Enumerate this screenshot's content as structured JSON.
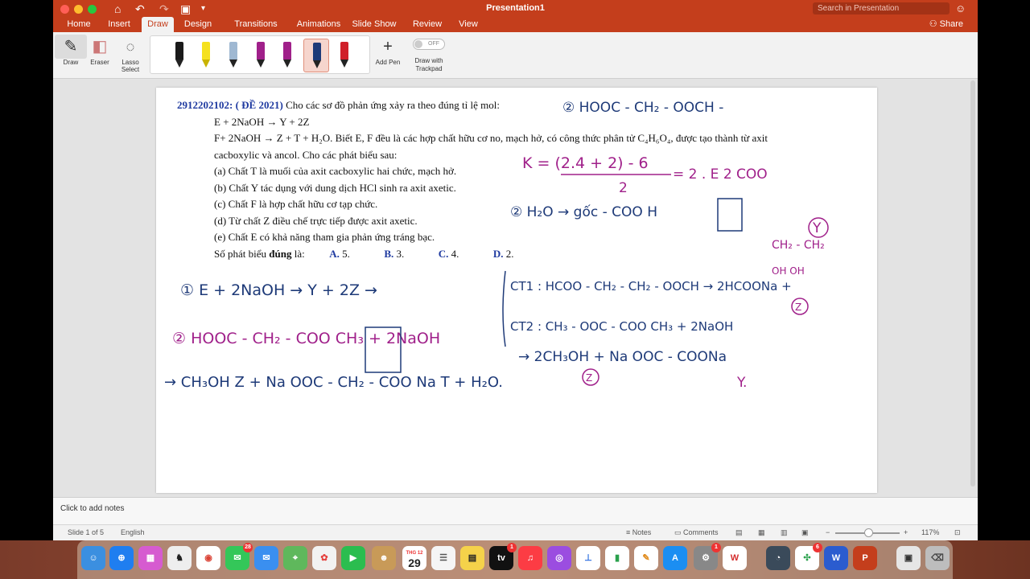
{
  "window": {
    "title": "Presentation1",
    "search_placeholder": "Search in Presentation",
    "share_label": "Share"
  },
  "tabs": [
    {
      "label": "Home"
    },
    {
      "label": "Insert"
    },
    {
      "label": "Draw"
    },
    {
      "label": "Design"
    },
    {
      "label": "Transitions"
    },
    {
      "label": "Animations"
    },
    {
      "label": "Slide Show"
    },
    {
      "label": "Review"
    },
    {
      "label": "View"
    }
  ],
  "ribbon": {
    "draw_label": "Draw",
    "eraser_label": "Eraser",
    "lasso_label": "Lasso Select",
    "add_pen_label": "Add Pen",
    "toggle_label": "OFF",
    "trackpad_label": "Draw with Trackpad",
    "pen_colors": [
      "#1a1a1a",
      "#f5e11e",
      "#9fb8d2",
      "#a0208a",
      "#a0208a",
      "#1e3a78",
      "#d0202a"
    ]
  },
  "slide": {
    "qid": "2912202102:",
    "qtag": "( ĐỀ 2021)",
    "intro": "Cho các sơ đồ phản ứng xảy ra theo đúng tỉ lệ mol:",
    "eq1": "E + 2NaOH → Y + 2Z",
    "eq2": "F+ 2NaOH → Z + T + H₂O. Biết E, F đều là các hợp chất hữu cơ no, mạch hở, có công thức phân tử C₄H₆O₄, được tạo thành từ axit",
    "eq2b": "cacboxylic và ancol. Cho các phát biểu sau:",
    "statements": [
      "(a) Chất T là muối của axit cacboxylic hai chức, mạch hở.",
      "(b) Chất Y tác dụng với dung dịch HCl sinh ra axit axetic.",
      "(c) Chất F là hợp chất hữu cơ tạp chức.",
      "(d) Từ chất Z điều chế trực tiếp được axit axetic.",
      "(e) Chất E có khả năng tham gia phản ứng tráng bạc."
    ],
    "count_label": "Số phát biểu",
    "count_bold": "đúng",
    "count_suffix": "là:",
    "answers": [
      {
        "key": "A.",
        "val": "5."
      },
      {
        "key": "B.",
        "val": "3."
      },
      {
        "key": "C.",
        "val": "4."
      },
      {
        "key": "D.",
        "val": "2."
      }
    ],
    "ink": {
      "top_right": "② HOOC - CH₂ - OOCH -",
      "k_formula": "K = (2.4 + 2) - 6",
      "k_denominator": "2",
      "k_result": "= 2 . E 2 COO",
      "h2o": "② H₂O → gốc - COO H",
      "y_label": "Y",
      "glycol": "CH₂ - CH₂",
      "glycol_oh": "OH      OH",
      "eq_e": "① E + 2NaOH → Y + 2Z →",
      "ct1": "CT1 : HCOO - CH₂ - CH₂ - OOCH → 2HCOONa +",
      "z_badge": "Z",
      "ct2": "CT2 : CH₃ - OOC - COO CH₃ + 2NaOH",
      "f_structure": "② HOOC - CH₂ - COO CH₃ + 2NaOH",
      "products1": "→ 2CH₃OH + Na OOC - COONa",
      "z2": "Z",
      "y2": "Y.",
      "products2": "→ CH₃OH Z + Na OOC - CH₂ - COO Na T + H₂O."
    }
  },
  "notes": {
    "placeholder": "Click to add notes"
  },
  "status": {
    "slide_info": "Slide 1 of 5",
    "language": "English",
    "notes_btn": "Notes",
    "comments_btn": "Comments",
    "zoom": "117%"
  },
  "dock": {
    "calendar_month": "THG 12",
    "calendar_day": "29",
    "badges": {
      "messages": "28",
      "appletv": "1",
      "settings": "1",
      "sheets": "6"
    }
  }
}
